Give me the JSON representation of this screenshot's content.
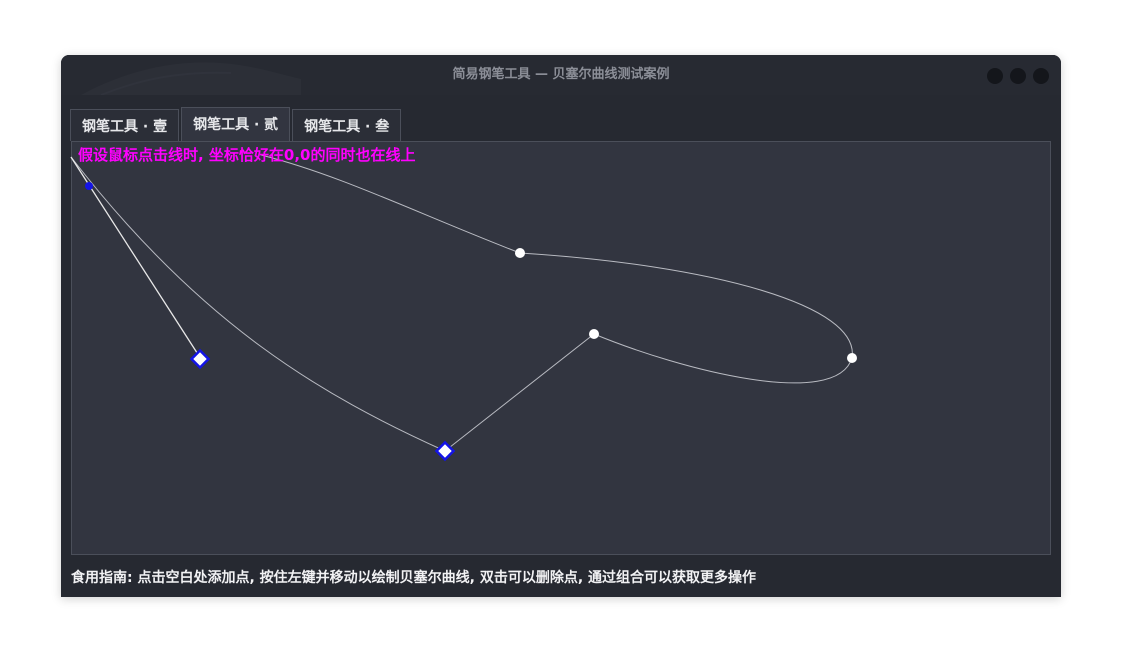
{
  "window": {
    "title": "简易钢笔工具 — 贝塞尔曲线测试案例",
    "control_icons": [
      "minimize-icon",
      "maximize-icon",
      "close-icon"
    ]
  },
  "tabs": [
    {
      "label": "钢笔工具 · 壹",
      "active": false
    },
    {
      "label": "钢笔工具 · 贰",
      "active": true
    },
    {
      "label": "钢笔工具 · 叁",
      "active": false
    }
  ],
  "canvas": {
    "overlay_text": "假设鼠标点击线时, 坐标恰好在0,0的同时也在线上",
    "colors": {
      "background": "#323540",
      "curve": "#b9bbc2",
      "control_point": "#ffffff",
      "selected_outline": "#1414e6",
      "overlay_text": "#ff00ff"
    }
  },
  "footer": {
    "guide": "食用指南: 点击空白处添加点, 按住左键并移动以绘制贝塞尔曲线, 双击可以删除点, 通过组合可以获取更多操作"
  }
}
